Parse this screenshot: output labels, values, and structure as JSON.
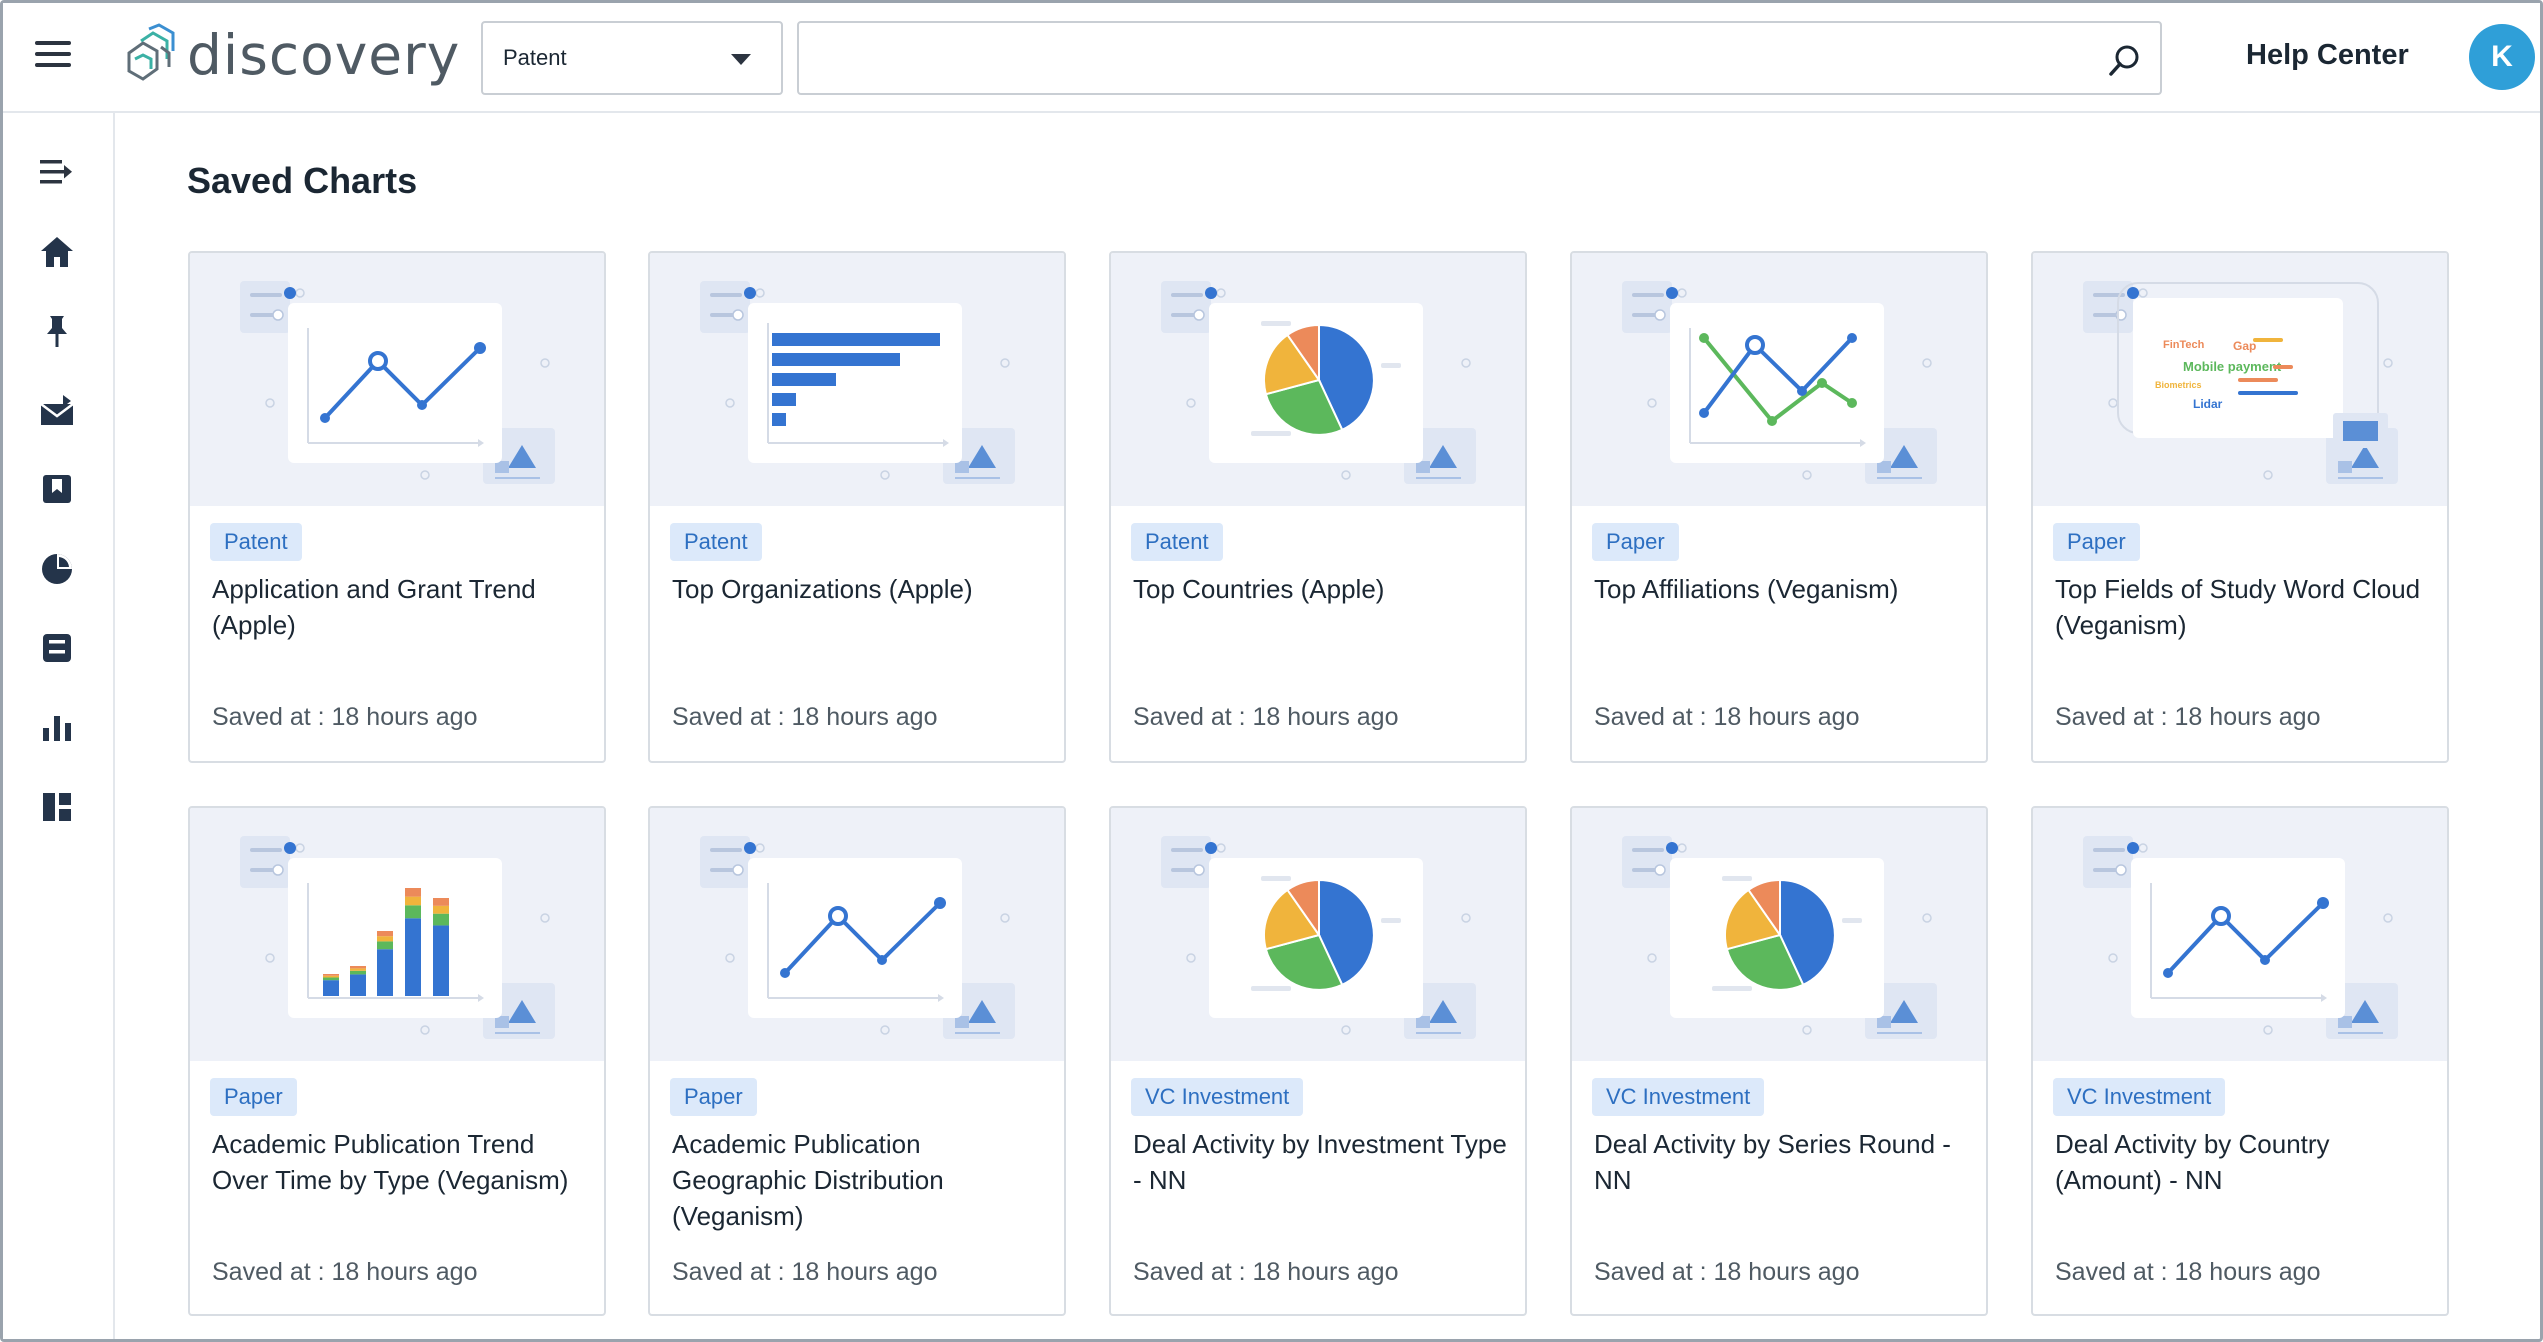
{
  "header": {
    "logo_text": "discovery",
    "select_value": "Patent",
    "search_placeholder": "",
    "help_label": "Help Center",
    "avatar_initial": "K"
  },
  "sidebar": {
    "items": [
      {
        "icon": "expand-icon"
      },
      {
        "icon": "home-icon"
      },
      {
        "icon": "pin-icon"
      },
      {
        "icon": "inbox-icon"
      },
      {
        "icon": "bookmark-icon"
      },
      {
        "icon": "pie-chart-icon"
      },
      {
        "icon": "save-icon"
      },
      {
        "icon": "bar-chart-icon"
      },
      {
        "icon": "dashboard-icon"
      }
    ]
  },
  "page": {
    "title": "Saved Charts"
  },
  "colors": {
    "accent": "#2f9fd8",
    "badge_bg": "#dce9fa",
    "badge_text": "#2d6fc1",
    "chart_blue": "#3474d1",
    "chart_green": "#5cb85c",
    "chart_yellow": "#f0b43c",
    "chart_orange": "#ec8a5a"
  },
  "cards": [
    {
      "badge": "Patent",
      "title": "Application and Grant Trend (Apple)",
      "saved_label": "Saved at :",
      "saved_value": "18 hours ago",
      "thumb": "line"
    },
    {
      "badge": "Patent",
      "title": "Top Organizations (Apple)",
      "saved_label": "Saved at :",
      "saved_value": "18 hours ago",
      "thumb": "hbar"
    },
    {
      "badge": "Patent",
      "title": "Top Countries (Apple)",
      "saved_label": "Saved at :",
      "saved_value": "18 hours ago",
      "thumb": "pie"
    },
    {
      "badge": "Paper",
      "title": "Top Affiliations (Veganism)",
      "saved_label": "Saved at :",
      "saved_value": "18 hours ago",
      "thumb": "multiline"
    },
    {
      "badge": "Paper",
      "title": "Top Fields of Study Word Cloud (Veganism)",
      "saved_label": "Saved at :",
      "saved_value": "18 hours ago",
      "thumb": "wordcloud"
    },
    {
      "badge": "Paper",
      "title": "Academic Publication Trend Over Time by Type (Veganism)",
      "saved_label": "Saved at :",
      "saved_value": "18 hours ago",
      "thumb": "stacked"
    },
    {
      "badge": "Paper",
      "title": "Academic Publication Geographic Distribution (Veganism)",
      "saved_label": "Saved at :",
      "saved_value": "18 hours ago",
      "thumb": "line"
    },
    {
      "badge": "VC Investment",
      "title": "Deal Activity by Investment Type - NN",
      "saved_label": "Saved at :",
      "saved_value": "18 hours ago",
      "thumb": "pie"
    },
    {
      "badge": "VC Investment",
      "title": "Deal Activity by Series Round - NN",
      "saved_label": "Saved at :",
      "saved_value": "18 hours ago",
      "thumb": "pie"
    },
    {
      "badge": "VC Investment",
      "title": "Deal Activity by Country (Amount) - NN",
      "saved_label": "Saved at :",
      "saved_value": "18 hours ago",
      "thumb": "line"
    }
  ],
  "wordcloud_words": [
    {
      "text": "FinTech",
      "color": "#ec8a5a"
    },
    {
      "text": "Gap",
      "color": "#ec8a5a"
    },
    {
      "text": "Mobile payment",
      "color": "#5cb85c"
    },
    {
      "text": "Biometrics",
      "color": "#f0b43c"
    },
    {
      "text": "Lidar",
      "color": "#3474d1"
    }
  ]
}
